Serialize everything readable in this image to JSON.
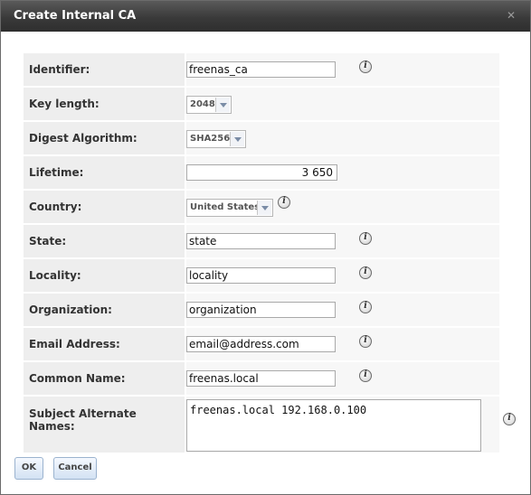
{
  "dialog": {
    "title": "Create Internal CA",
    "close_icon": "close-icon"
  },
  "form": {
    "identifier": {
      "label": "Identifier:",
      "value": "freenas_ca"
    },
    "key_length": {
      "label": "Key length:",
      "selected": "2048"
    },
    "digest_algorithm": {
      "label": "Digest Algorithm:",
      "selected": "SHA256"
    },
    "lifetime": {
      "label": "Lifetime:",
      "value": "3 650"
    },
    "country": {
      "label": "Country:",
      "selected": "United States"
    },
    "state": {
      "label": "State:",
      "value": "state"
    },
    "locality": {
      "label": "Locality:",
      "value": "locality"
    },
    "organization": {
      "label": "Organization:",
      "value": "organization"
    },
    "email": {
      "label": "Email Address:",
      "value": "email@address.com"
    },
    "common_name": {
      "label": "Common Name:",
      "value": "freenas.local"
    },
    "san": {
      "label": "Subject Alternate Names:",
      "value": "freenas.local 192.168.0.100"
    }
  },
  "buttons": {
    "ok": "OK",
    "cancel": "Cancel"
  },
  "icons": {
    "help": "info-icon",
    "dropdown": "chevron-down-icon"
  }
}
